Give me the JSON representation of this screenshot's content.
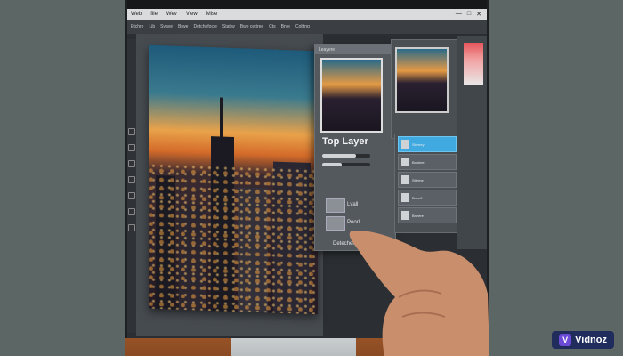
{
  "menu": {
    "items": [
      "Web",
      "file",
      "Wev",
      "View",
      "Mise"
    ]
  },
  "options": {
    "items": [
      "Etchre",
      "Lib",
      "Svave",
      "Brwe",
      "Detchnfocie",
      "Stattw",
      "Bwe cettree",
      "Cts",
      "Brve",
      "Colttng"
    ]
  },
  "layers_panel": {
    "header": "Leayere",
    "title": "Top Layer",
    "bottom_label": "Detechert",
    "small_labels": [
      "Lvall",
      "Poorl"
    ]
  },
  "layers_list": {
    "rows": [
      "Sbeeey",
      "Boolme",
      "Stteme",
      "Bneefl",
      "Bneere"
    ]
  },
  "logo": {
    "text": "Vidnoz",
    "mark": "V"
  }
}
